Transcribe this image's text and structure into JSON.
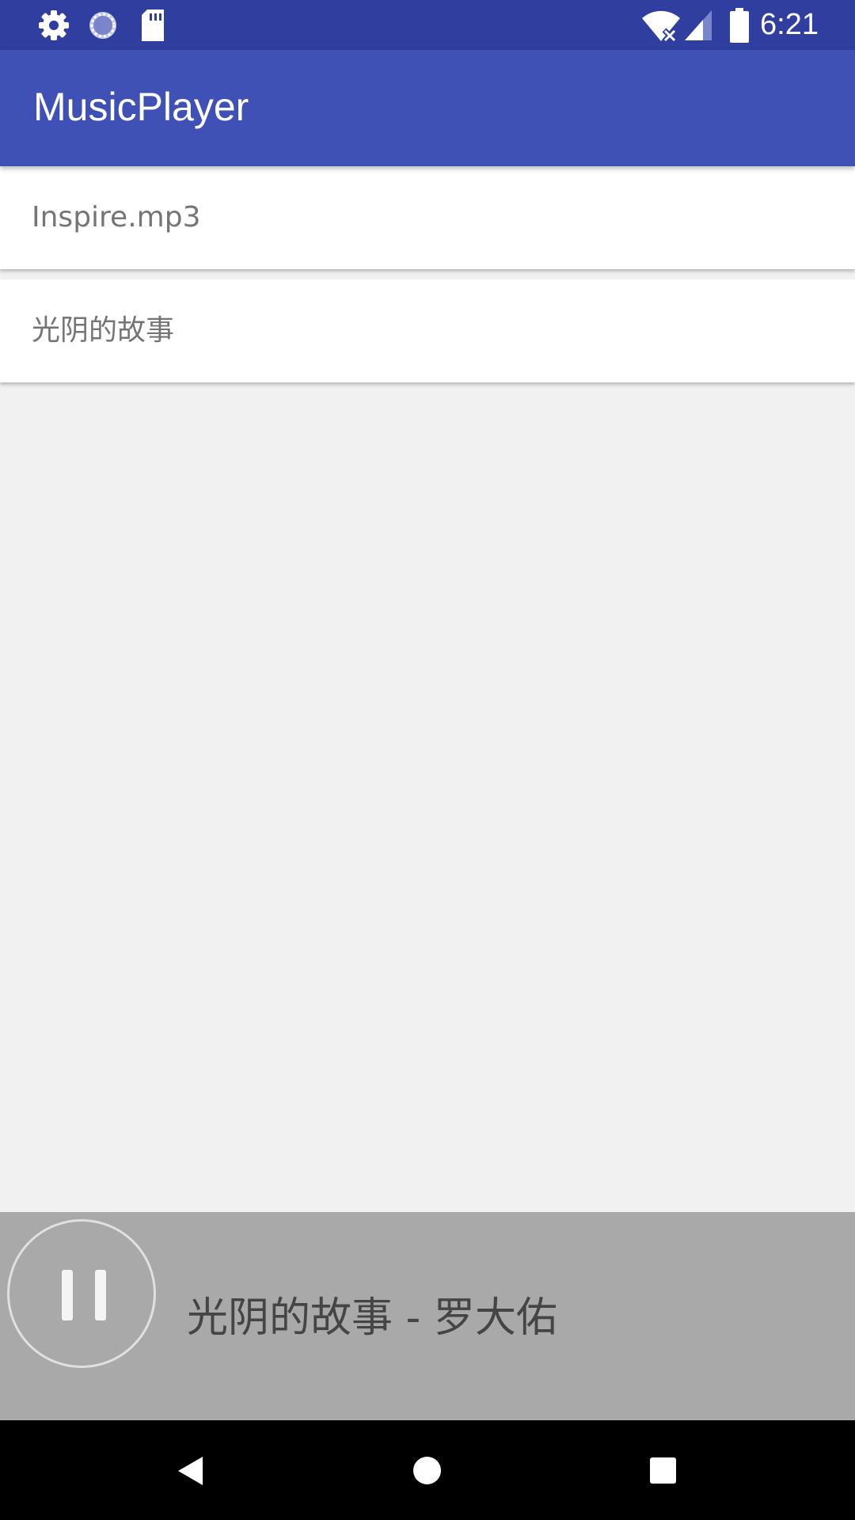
{
  "status_bar": {
    "time": "6:21",
    "icons": [
      "gear-icon",
      "sync-icon",
      "sd-card-icon",
      "wifi-off-icon",
      "cell-signal-icon",
      "battery-icon"
    ]
  },
  "app_bar": {
    "title": "MusicPlayer"
  },
  "songs": [
    {
      "label": "Inspire.mp3"
    },
    {
      "label": "光阴的故事"
    }
  ],
  "player": {
    "now_playing": "光阴的故事 - 罗大佑",
    "state_icon": "pause-icon"
  },
  "nav_bar": {
    "icons": [
      "back-icon",
      "home-icon",
      "recents-icon"
    ]
  },
  "colors": {
    "status_bar": "#303f9f",
    "app_bar": "#3f51b5",
    "background": "#f1f1f1",
    "player_bar": "#a9a9a9"
  }
}
